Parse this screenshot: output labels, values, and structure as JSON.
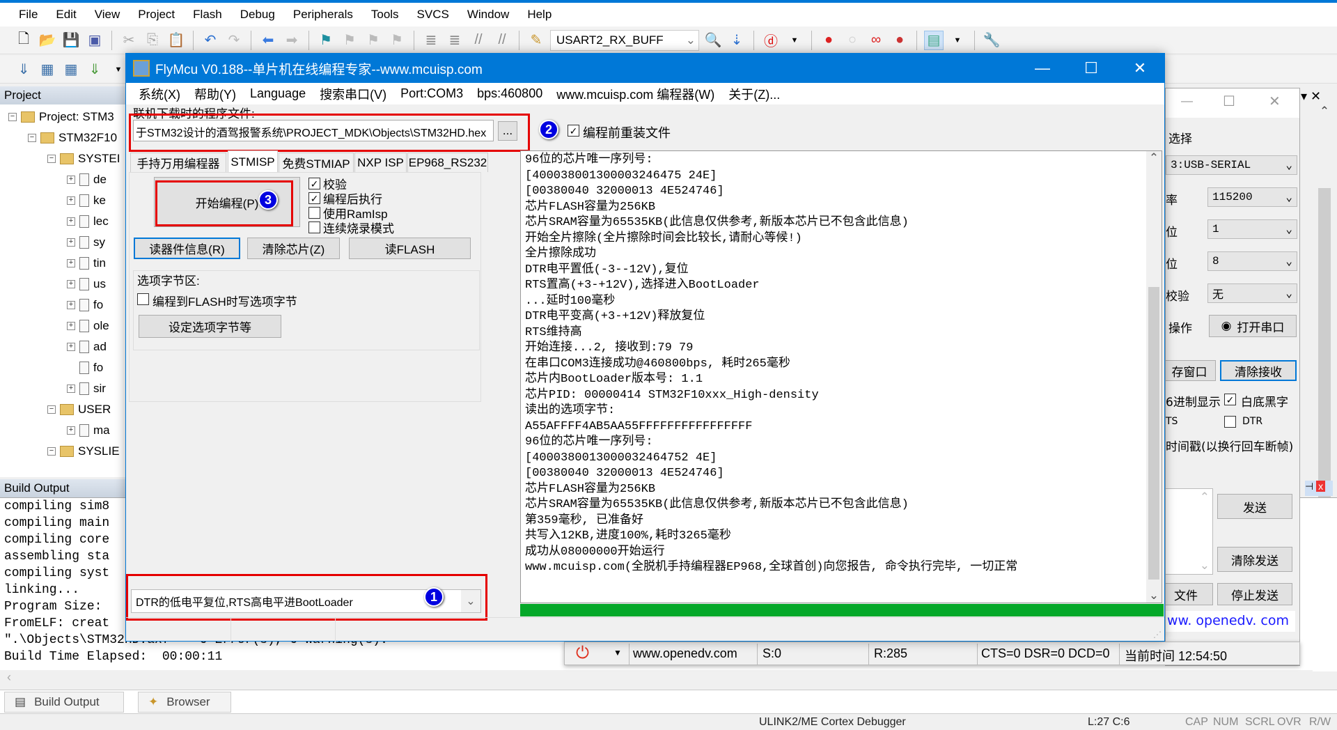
{
  "ide": {
    "menu": [
      "File",
      "Edit",
      "View",
      "Project",
      "Flash",
      "Debug",
      "Peripherals",
      "Tools",
      "SVCS",
      "Window",
      "Help"
    ],
    "toolbar_combo": "USART2_RX_BUFF",
    "project_header": "Project",
    "tree": [
      {
        "label": "Project: STM3",
        "level": 0,
        "type": "project",
        "toggle": "−"
      },
      {
        "label": "STM32F10",
        "level": 1,
        "type": "target",
        "toggle": "−"
      },
      {
        "label": "SYSTEI",
        "level": 2,
        "type": "folder",
        "toggle": "−"
      },
      {
        "label": "de",
        "level": 3,
        "type": "file",
        "toggle": "+"
      },
      {
        "label": "ke",
        "level": 3,
        "type": "file",
        "toggle": "+"
      },
      {
        "label": "lec",
        "level": 3,
        "type": "file",
        "toggle": "+"
      },
      {
        "label": "sy",
        "level": 3,
        "type": "file",
        "toggle": "+"
      },
      {
        "label": "tin",
        "level": 3,
        "type": "file",
        "toggle": "+"
      },
      {
        "label": "us",
        "level": 3,
        "type": "file",
        "toggle": "+"
      },
      {
        "label": "fo",
        "level": 3,
        "type": "file",
        "toggle": "+"
      },
      {
        "label": "ole",
        "level": 3,
        "type": "file",
        "toggle": "+"
      },
      {
        "label": "ad",
        "level": 3,
        "type": "file",
        "toggle": "+"
      },
      {
        "label": "fo",
        "level": 3,
        "type": "file",
        "toggle": ""
      },
      {
        "label": "sir",
        "level": 3,
        "type": "file",
        "toggle": "+"
      },
      {
        "label": "USER",
        "level": 2,
        "type": "folder",
        "toggle": "−"
      },
      {
        "label": "ma",
        "level": 3,
        "type": "file",
        "toggle": "+"
      },
      {
        "label": "SYSLIE",
        "level": 2,
        "type": "folder",
        "toggle": "−"
      }
    ],
    "build_output_header": "Build Output",
    "build_output": [
      "compiling sim8",
      "compiling main",
      "compiling core",
      "assembling sta",
      "compiling syst",
      "linking...",
      "Program Size: ",
      "FromELF: creat",
      "\".\\Objects\\STM32HD.axf\" - 0 Error(s), 0 Warning(s).",
      "Build Time Elapsed:  00:00:11"
    ],
    "bottom_tabs": [
      "Build Output",
      "Browser"
    ],
    "status": {
      "debugger": "ULINK2/ME Cortex Debugger",
      "position": "L:27 C:6",
      "cap": "CAP",
      "num": "NUM",
      "scrl": "SCRL",
      "ovr": "OVR",
      "rw": "R/W"
    }
  },
  "flymcu": {
    "title": "FlyMcu V0.188--单片机在线编程专家--www.mcuisp.com",
    "menu": [
      "系统(X)",
      "帮助(Y)",
      "Language",
      "搜索串口(V)",
      "Port:COM3",
      "bps:460800",
      "www.mcuisp.com 编程器(W)",
      "关于(Z)..."
    ],
    "file_label": "联机下载时的程序文件:",
    "file_path": "于STM32设计的酒驾报警系统\\PROJECT_MDK\\Objects\\STM32HD.hex",
    "browse_label": "...",
    "reload_label": "编程前重装文件",
    "reload_checked": true,
    "tabs": [
      "手持万用编程器",
      "STMISP",
      "免费STMIAP",
      "NXP ISP",
      "EP968_RS232"
    ],
    "selected_tab": "STMISP",
    "start_button": "开始编程(P)",
    "options": [
      {
        "label": "校验",
        "checked": true
      },
      {
        "label": "编程后执行",
        "checked": true
      },
      {
        "label": "使用RamIsp",
        "checked": false
      },
      {
        "label": "连续烧录模式",
        "checked": false
      }
    ],
    "read_info_button": "读器件信息(R)",
    "erase_button": "清除芯片(Z)",
    "read_flash_button": "读FLASH",
    "option_group_label": "选项字节区:",
    "option_write_label": "编程到FLASH时写选项字节",
    "option_write_checked": false,
    "set_option_button": "设定选项字节等",
    "reset_mode": "DTR的低电平复位,RTS高电平进BootLoader",
    "annotations": [
      "1",
      "2",
      "3"
    ],
    "log": [
      "96位的芯片唯一序列号:",
      "[400038001300003246475 24E]",
      "[00380040 32000013 4E524746]",
      "芯片FLASH容量为256KB",
      "芯片SRAM容量为65535KB(此信息仅供参考,新版本芯片已不包含此信息)",
      "开始全片擦除(全片擦除时间会比较长,请耐心等候!)",
      "全片擦除成功",
      "DTR电平置低(-3--12V),复位",
      "RTS置高(+3-+12V),选择进入BootLoader",
      "...延时100毫秒",
      "DTR电平变高(+3-+12V)释放复位",
      "RTS维持高",
      "开始连接...2, 接收到:79 79",
      "在串口COM3连接成功@460800bps, 耗时265毫秒",
      "芯片内BootLoader版本号: 1.1",
      "芯片PID: 00000414  STM32F10xxx_High-density",
      "读出的选项字节:",
      "A55AFFFF4AB5AA55FFFFFFFFFFFFFFFF",
      "96位的芯片唯一序列号:",
      "[4000380013000032464752 4E]",
      "[00380040 32000013 4E524746]",
      "芯片FLASH容量为256KB",
      "芯片SRAM容量为65535KB(此信息仅供参考,新版本芯片已不包含此信息)",
      "第359毫秒, 已准备好",
      "共写入12KB,进度100%,耗时3265毫秒",
      "成功从08000000开始运行",
      "www.mcuisp.com(全脱机手持编程器EP968,全球首创)向您报告, 命令执行完毕, 一切正常"
    ],
    "progress_percent": 100,
    "progress_color": "#05a829"
  },
  "serial": {
    "port_label": "选择",
    "port_value": "3:USB-SERIAL",
    "baud_label": "率",
    "baud_value": "115200",
    "stop_label": "位",
    "stop_value": "1",
    "data_label": "位",
    "data_value": "8",
    "parity_label": "校验",
    "parity_value": "无",
    "op_label": "操作",
    "open_button": "打开串口",
    "save_button": "存窗口",
    "clear_recv_button": "清除接收",
    "hex_label": "6进制显示",
    "white_label": "白底黑字",
    "white_checked": true,
    "rts_label": "TS",
    "dtr_label": "DTR",
    "dtr_checked": false,
    "timestamp_label": "时间戳(以换行回车断帧)",
    "send_button": "发送",
    "clear_send_button": "清除发送",
    "file_button": "文件",
    "stop_send_button": "停止发送",
    "link": "ww. openedv. com",
    "status": {
      "site": "www.openedv.com",
      "sent": "S:0",
      "received": "R:285",
      "lines": "CTS=0 DSR=0 DCD=0",
      "time": "当前时间 12:54:50"
    }
  }
}
